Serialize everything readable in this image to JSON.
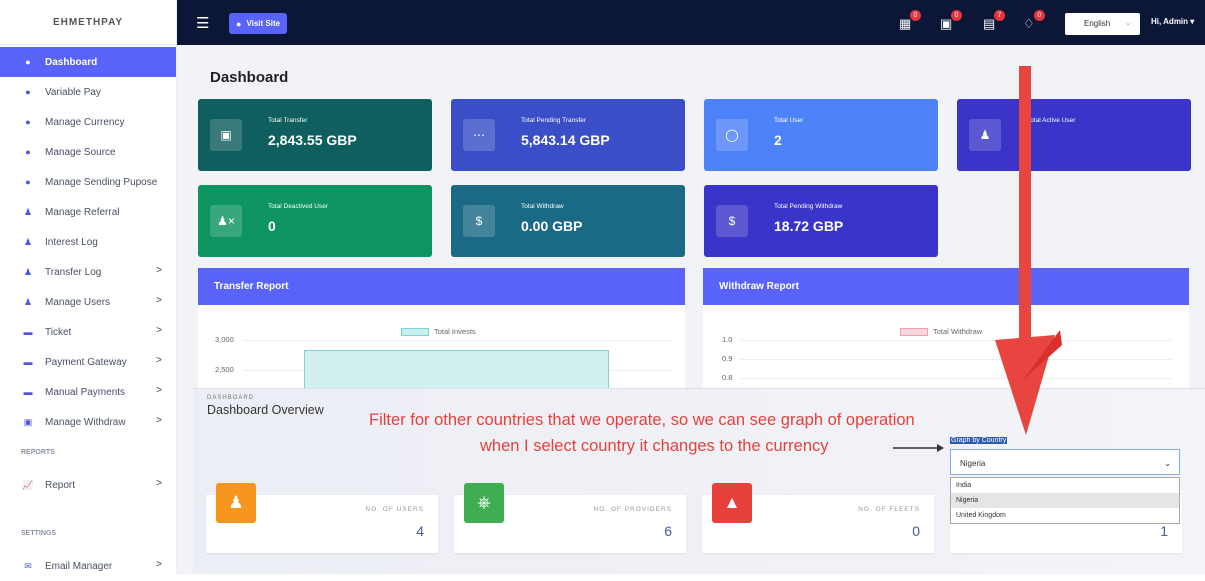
{
  "brand": "EHMETHPAY",
  "sidebar": {
    "items": [
      {
        "label": "Dashboard",
        "icon": "dashboard-icon",
        "active": true
      },
      {
        "label": "Variable Pay",
        "icon": "dot-icon"
      },
      {
        "label": "Manage Currency",
        "icon": "dot-icon"
      },
      {
        "label": "Manage Source",
        "icon": "dot-icon"
      },
      {
        "label": "Manage Sending Pupose",
        "icon": "dot-icon"
      },
      {
        "label": "Manage Referral",
        "icon": "user-icon"
      },
      {
        "label": "Interest Log",
        "icon": "user-icon"
      },
      {
        "label": "Transfer Log",
        "icon": "users-icon",
        "arrow": ">"
      },
      {
        "label": "Manage Users",
        "icon": "users-icon",
        "arrow": ">"
      },
      {
        "label": "Ticket",
        "icon": "ticket-icon",
        "arrow": ">"
      },
      {
        "label": "Payment Gateway",
        "icon": "card-icon",
        "arrow": ">"
      },
      {
        "label": "Manual Payments",
        "icon": "card-icon",
        "arrow": ">"
      },
      {
        "label": "Manage Withdraw",
        "icon": "money-icon",
        "arrow": ">"
      }
    ],
    "section_reports": "REPORTS",
    "report_item": {
      "label": "Report",
      "arrow": ">"
    },
    "section_settings": "SETTINGS",
    "email_item": {
      "label": "Email Manager",
      "arrow": ">"
    }
  },
  "topbar": {
    "visit_label": "Visit Site",
    "badges": [
      "0",
      "0",
      "7",
      "0"
    ],
    "language": "English",
    "admin": "Hi, Admin"
  },
  "page_title": "Dashboard",
  "cards": [
    {
      "label": "Total Transfer",
      "value": "2,843.55 GBP",
      "color": "#0e5f5e"
    },
    {
      "label": "Total Pending Transfer",
      "value": "5,843.14 GBP",
      "color": "#3a4fc7"
    },
    {
      "label": "Total User",
      "value": "2",
      "color": "#4d82f8"
    },
    {
      "label": "Total Active User",
      "value": "",
      "color": "#3a34c9"
    },
    {
      "label": "Total Deactived User",
      "value": "0",
      "color": "#0e9460"
    },
    {
      "label": "Total Withdraw",
      "value": "0.00 GBP",
      "color": "#1a6a85"
    },
    {
      "label": "Total Pending Withdraw",
      "value": "18.72 GBP",
      "color": "#3a34c9"
    }
  ],
  "transfer_report": {
    "title": "Transfer Report",
    "legend": "Total Invests",
    "yticks": [
      "3,000",
      "2,500"
    ]
  },
  "withdraw_report": {
    "title": "Withdraw Report",
    "legend": "Total Withdraw",
    "yticks": [
      "1.0",
      "0.9",
      "0.8"
    ]
  },
  "overview": {
    "small": "DASHBOARD",
    "title": "Dashboard Overview",
    "annotation_line1": "Filter for other countries that we operate, so we can see graph of operation",
    "annotation_line2": "when I select country it changes to the currency",
    "graph_label": "Graph by Country",
    "selected_country": "Nigeria",
    "options": [
      "India",
      "Nigeria",
      "United Kingdom"
    ],
    "stats": [
      {
        "label": "NO. OF USERS",
        "value": "4",
        "color": "#f7961e"
      },
      {
        "label": "NO. OF PROVIDERS",
        "value": "6",
        "color": "#3fae52"
      },
      {
        "label": "NO. OF FLEETS",
        "value": "0",
        "color": "#e8403a"
      },
      {
        "label": "",
        "value": "1",
        "color": "#6fd0cf"
      }
    ]
  }
}
